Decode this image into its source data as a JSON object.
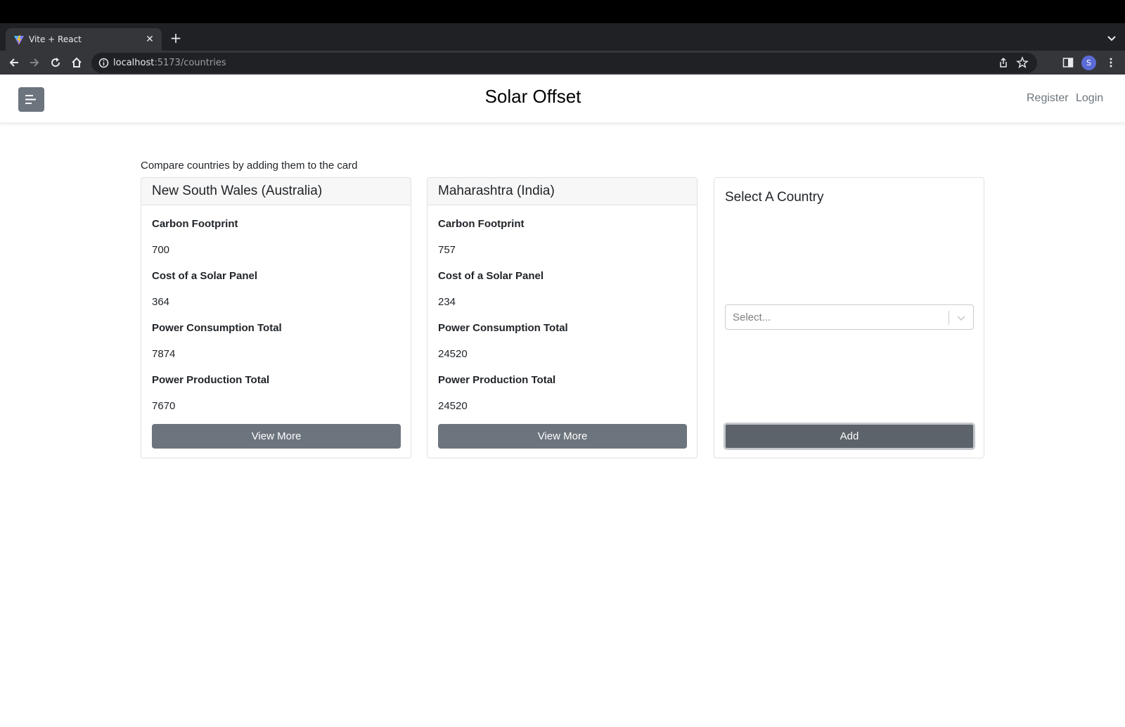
{
  "browser": {
    "tab_title": "Vite + React",
    "url_host": "localhost",
    "url_path": ":5173/countries",
    "profile_initial": "S"
  },
  "navbar": {
    "title": "Solar Offset",
    "register_label": "Register",
    "login_label": "Login"
  },
  "intro_text": "Compare countries by adding them to the card",
  "cards": [
    {
      "name": "New South Wales (Australia)",
      "metrics": [
        {
          "label": "Carbon Footprint",
          "value": "700"
        },
        {
          "label": "Cost of a Solar Panel",
          "value": "364"
        },
        {
          "label": "Power Consumption Total",
          "value": "7874"
        },
        {
          "label": "Power Production Total",
          "value": "7670"
        }
      ],
      "button_label": "View More"
    },
    {
      "name": "Maharashtra (India)",
      "metrics": [
        {
          "label": "Carbon Footprint",
          "value": "757"
        },
        {
          "label": "Cost of a Solar Panel",
          "value": "234"
        },
        {
          "label": "Power Consumption Total",
          "value": "24520"
        },
        {
          "label": "Power Production Total",
          "value": "24520"
        }
      ],
      "button_label": "View More"
    }
  ],
  "selector": {
    "title": "Select A Country",
    "placeholder": "Select...",
    "button_label": "Add"
  },
  "colors": {
    "secondary": "#6c757d",
    "secondary_active": "#5c636a",
    "browser_dark": "#202124",
    "browser_toolbar": "#35363a"
  }
}
